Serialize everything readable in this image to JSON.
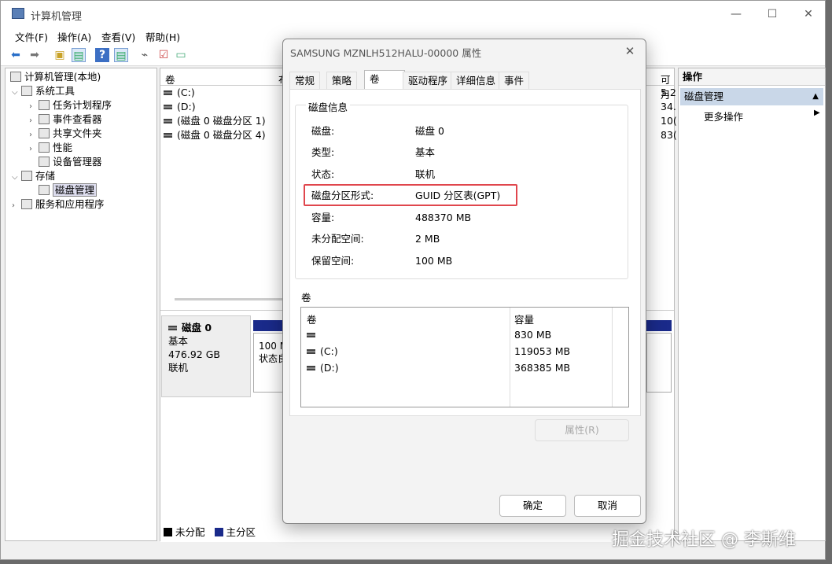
{
  "window": {
    "title": "计算机管理",
    "minimize": "—",
    "maximize": "☐",
    "close": "✕"
  },
  "menu": [
    "文件(F)",
    "操作(A)",
    "查看(V)",
    "帮助(H)"
  ],
  "tree": {
    "root": "计算机管理(本地)",
    "system_tools": "系统工具",
    "task_scheduler": "任务计划程序",
    "event_viewer": "事件查看器",
    "shared_folders": "共享文件夹",
    "performance": "性能",
    "device_manager": "设备管理器",
    "storage": "存储",
    "disk_management": "磁盘管理",
    "services_apps": "服务和应用程序"
  },
  "volume_table": {
    "col_volume": "卷",
    "col_layout": "布",
    "col_free": "可月",
    "rows": [
      {
        "name": "(C:)",
        "right": "5.2"
      },
      {
        "name": "(D:)",
        "right": "34."
      },
      {
        "name": "(磁盘 0 磁盘分区 1)",
        "right": "10("
      },
      {
        "name": "(磁盘 0 磁盘分区 4)",
        "right": "83("
      }
    ]
  },
  "disk_panel": {
    "disk_name": "磁盘 0",
    "type": "基本",
    "size": "476.92 GB",
    "status": "联机",
    "partition_text_1": "100 M",
    "partition_text_2": "状态良",
    "legend_unallocated": "未分配",
    "legend_primary": "主分区"
  },
  "actions_pane": {
    "title": "操作",
    "section": "磁盘管理",
    "more": "更多操作"
  },
  "dialog": {
    "title": "SAMSUNG MZNLH512HALU-00000 属性",
    "tabs": [
      "常规",
      "策略",
      "卷",
      "驱动程序",
      "详细信息",
      "事件"
    ],
    "active_tab": "卷",
    "disk_info_label": "磁盘信息",
    "props": [
      {
        "label": "磁盘:",
        "value": "磁盘 0"
      },
      {
        "label": "类型:",
        "value": "基本"
      },
      {
        "label": "状态:",
        "value": "联机"
      },
      {
        "label": "磁盘分区形式:",
        "value": "GUID 分区表(GPT)"
      },
      {
        "label": "容量:",
        "value": "488370 MB"
      },
      {
        "label": "未分配空间:",
        "value": "2 MB"
      },
      {
        "label": "保留空间:",
        "value": "100 MB"
      }
    ],
    "volumes_label": "卷",
    "volumes_header": {
      "volume": "卷",
      "capacity": "容量"
    },
    "volumes": [
      {
        "name": "",
        "capacity": "830 MB"
      },
      {
        "name": "(C:)",
        "capacity": "119053 MB"
      },
      {
        "name": "(D:)",
        "capacity": "368385 MB"
      }
    ],
    "properties_button": "属性(R)",
    "ok_button": "确定",
    "cancel_button": "取消"
  },
  "watermark": "掘金技术社区 @ 李斯维",
  "highlight_color": "#e0464d"
}
